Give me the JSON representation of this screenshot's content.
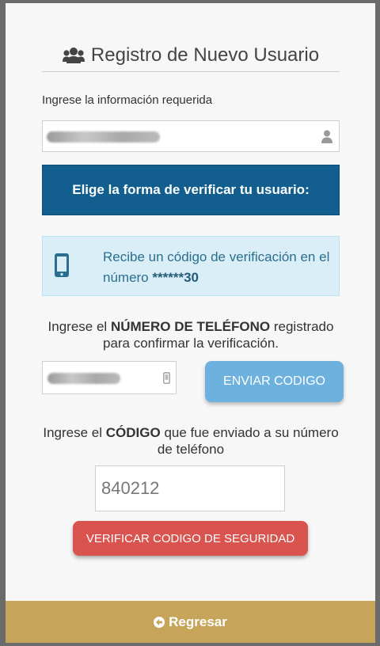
{
  "header": {
    "title": "Registro de Nuevo Usuario",
    "icon": "users-icon"
  },
  "form": {
    "required_label": "Ingrese la información requerida",
    "banner": "Elige la forma de verificar tu usuario:",
    "info": {
      "text": "Recibe un código de verificación en el número",
      "masked_number": "******30"
    },
    "phone_prompt": {
      "pre": "Ingrese el",
      "bold": "NÚMERO DE TELÉFONO",
      "post": "registrado para confirmar la verificación."
    },
    "send_button": "ENVIAR CODIGO",
    "code_prompt": {
      "pre": "Ingrese el",
      "bold": "CÓDIGO",
      "post": "que fue enviado a su número de teléfono"
    },
    "code_value": "840212",
    "verify_button": "VERIFICAR CODIGO DE SEGURIDAD"
  },
  "footer": {
    "back_label": "Regresar"
  },
  "colors": {
    "banner": "#115e8f",
    "info_bg": "#d9eef7",
    "send_button": "#6db1df",
    "verify_button": "#d9534f",
    "footer": "#c6a55a"
  }
}
